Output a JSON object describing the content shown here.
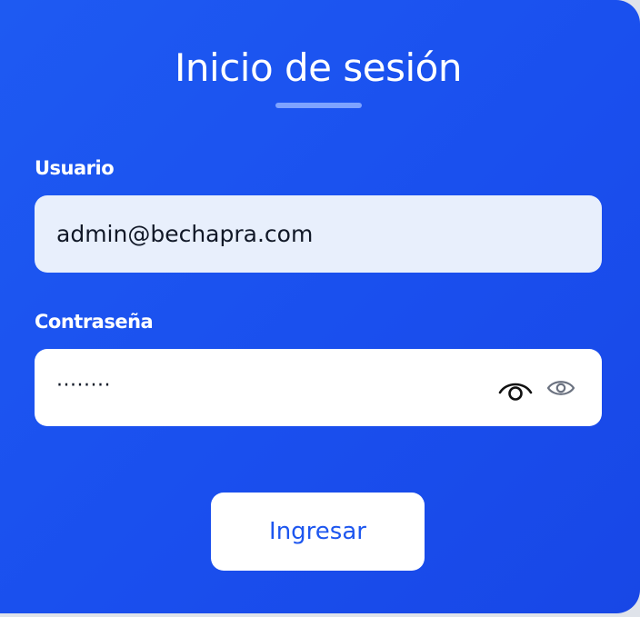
{
  "login": {
    "title": "Inicio de sesión",
    "username_label": "Usuario",
    "username_value": "admin@bechapra.com",
    "password_label": "Contraseña",
    "password_masked": "········",
    "submit_label": "Ingresar"
  },
  "icons": {
    "password_toggle": "eye-icon",
    "native_reveal": "eye-icon"
  },
  "colors": {
    "background": "#1a4fee",
    "accent_underline": "#7ea3ff",
    "username_field_bg": "#e8effc",
    "button_text": "#1d56ef"
  }
}
